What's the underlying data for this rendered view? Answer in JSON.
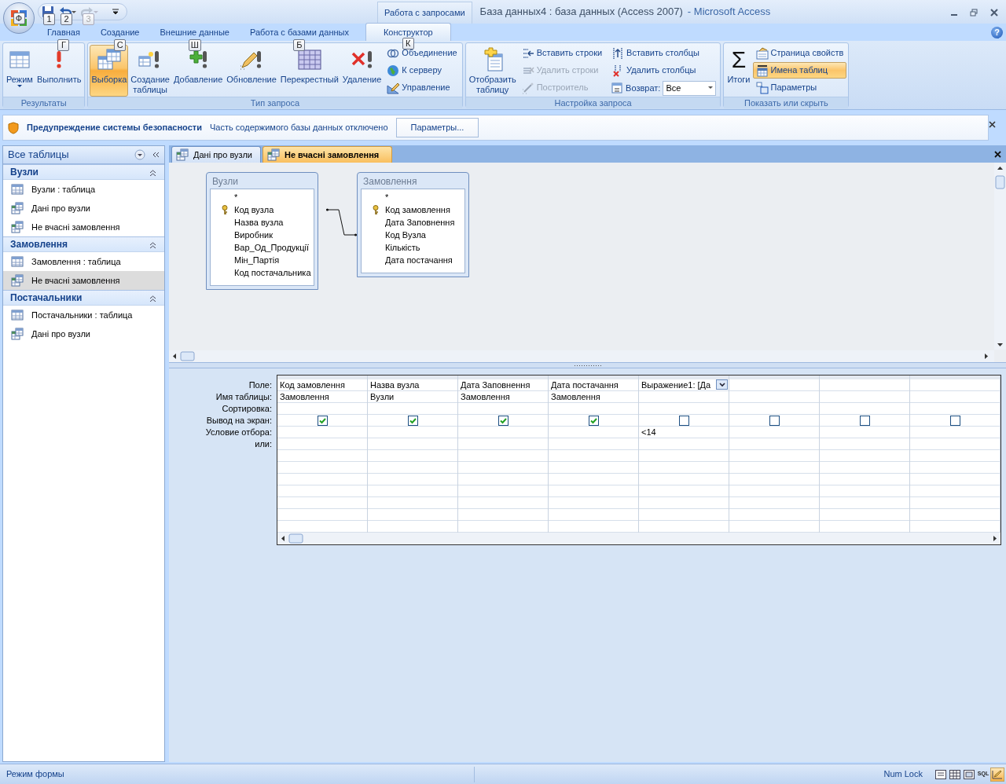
{
  "office_button": {
    "keytip": "Ф"
  },
  "quick_access": [
    {
      "keytip": "1",
      "disabled": false
    },
    {
      "keytip": "2",
      "disabled": false
    },
    {
      "keytip": "3",
      "disabled": true
    }
  ],
  "contextual_tab_group": "Работа с запросами",
  "window": {
    "title": "База данных4 : база данных (Access 2007)",
    "app_name": "- Microsoft Access"
  },
  "help_glyph": "?",
  "ribbon_tabs": [
    {
      "label": "Главная",
      "keytip": "Г",
      "selected": false
    },
    {
      "label": "Создание",
      "keytip": "С",
      "selected": false
    },
    {
      "label": "Внешние данные",
      "keytip": "Ш",
      "selected": false
    },
    {
      "label": "Работа с базами данных",
      "keytip": "Б",
      "selected": false
    },
    {
      "label": "Конструктор",
      "keytip": "К",
      "selected": true
    }
  ],
  "ribbon_groups": [
    {
      "name": "Результаты",
      "items": [
        {
          "kind": "large",
          "label": "Режим",
          "dropdown": true,
          "selected": false,
          "disabled": false
        },
        {
          "kind": "large",
          "label": "Выполнить",
          "dropdown": false,
          "selected": false,
          "disabled": false
        }
      ]
    },
    {
      "name": "Тип запроса",
      "items": [
        {
          "kind": "large",
          "label": "Выборка",
          "dropdown": false,
          "selected": true,
          "disabled": false
        },
        {
          "kind": "large",
          "label": "Создание таблицы",
          "dropdown": false,
          "selected": false,
          "disabled": false
        },
        {
          "kind": "large",
          "label": "Добавление",
          "dropdown": false,
          "selected": false,
          "disabled": false
        },
        {
          "kind": "large",
          "label": "Обновление",
          "dropdown": false,
          "selected": false,
          "disabled": false
        },
        {
          "kind": "large",
          "label": "Перекрестный",
          "dropdown": false,
          "selected": false,
          "disabled": false
        },
        {
          "kind": "large",
          "label": "Удаление",
          "dropdown": false,
          "selected": false,
          "disabled": false
        },
        {
          "kind": "small",
          "label": "Объединение",
          "selected": false,
          "disabled": false
        },
        {
          "kind": "small",
          "label": "К серверу",
          "selected": false,
          "disabled": false
        },
        {
          "kind": "small",
          "label": "Управление",
          "selected": false,
          "disabled": false
        }
      ]
    },
    {
      "name": "Настройка запроса",
      "items": [
        {
          "kind": "large",
          "label": "Отобразить таблицу",
          "dropdown": false,
          "selected": false,
          "disabled": false
        },
        {
          "kind": "small",
          "label": "Вставить строки",
          "selected": false,
          "disabled": false
        },
        {
          "kind": "small",
          "label": "Удалить строки",
          "selected": false,
          "disabled": true
        },
        {
          "kind": "small",
          "label": "Построитель",
          "selected": false,
          "disabled": true
        },
        {
          "kind": "small",
          "label": "Вставить столбцы",
          "selected": false,
          "disabled": false
        },
        {
          "kind": "small",
          "label": "Удалить столбцы",
          "selected": false,
          "disabled": false
        },
        {
          "kind": "combo",
          "label": "Возврат:",
          "value": "Все",
          "disabled": false
        }
      ]
    },
    {
      "name": "Показать или скрыть",
      "items": [
        {
          "kind": "large",
          "label": "Итоги",
          "glyph": "Σ",
          "dropdown": false,
          "selected": false,
          "disabled": false
        },
        {
          "kind": "small",
          "label": "Страница свойств",
          "selected": false,
          "disabled": false
        },
        {
          "kind": "small",
          "label": "Имена таблиц",
          "selected": true,
          "disabled": false
        },
        {
          "kind": "small",
          "label": "Параметры",
          "selected": false,
          "disabled": false
        }
      ]
    }
  ],
  "security_bar": {
    "title": "Предупреждение системы безопасности",
    "message": "Часть содержимого базы данных отключено",
    "button": "Параметры..."
  },
  "nav_pane": {
    "title": "Все таблицы",
    "groups": [
      {
        "name": "Вузли",
        "expanded": true,
        "items": [
          {
            "label": "Вузли : таблица",
            "kind": "table",
            "selected": false
          },
          {
            "label": "Дані про вузли",
            "kind": "query",
            "selected": false
          },
          {
            "label": "Не вчасні замовлення",
            "kind": "query",
            "selected": false
          }
        ]
      },
      {
        "name": "Замовлення",
        "expanded": true,
        "items": [
          {
            "label": "Замовлення : таблица",
            "kind": "table",
            "selected": false
          },
          {
            "label": "Не вчасні замовлення",
            "kind": "query",
            "selected": true
          }
        ]
      },
      {
        "name": "Постачальники",
        "expanded": true,
        "items": [
          {
            "label": "Постачальники : таблица",
            "kind": "table",
            "selected": false
          },
          {
            "label": "Дані про вузли",
            "kind": "query",
            "selected": false
          }
        ]
      }
    ]
  },
  "document_tabs": [
    {
      "label": "Дані про вузли",
      "selected": false
    },
    {
      "label": "Не вчасні замовлення",
      "selected": true
    }
  ],
  "diagram": {
    "tables": [
      {
        "name": "Вузли",
        "fields": [
          {
            "name": "*",
            "primary_key": false,
            "joined": false
          },
          {
            "name": "Код вузла",
            "primary_key": true,
            "joined": true
          },
          {
            "name": "Назва вузла",
            "primary_key": false,
            "joined": false
          },
          {
            "name": "Виробник",
            "primary_key": false,
            "joined": false
          },
          {
            "name": "Вар_Од_Продукції",
            "primary_key": false,
            "joined": false
          },
          {
            "name": "Мін_Партія",
            "primary_key": false,
            "joined": false
          },
          {
            "name": "Код постачальника",
            "primary_key": false,
            "joined": false
          }
        ]
      },
      {
        "name": "Замовлення",
        "fields": [
          {
            "name": "*",
            "primary_key": false,
            "joined": false
          },
          {
            "name": "Код замовлення",
            "primary_key": true,
            "joined": false
          },
          {
            "name": "Дата Заповнення",
            "primary_key": false,
            "joined": false
          },
          {
            "name": "Код Вузла",
            "primary_key": false,
            "joined": true
          },
          {
            "name": "Кількість",
            "primary_key": false,
            "joined": false
          },
          {
            "name": "Дата постачання",
            "primary_key": false,
            "joined": false
          }
        ]
      }
    ]
  },
  "grid": {
    "row_labels": [
      "Поле:",
      "Имя таблицы:",
      "Сортировка:",
      "Вывод на экран:",
      "Условие отбора:",
      "или:"
    ],
    "columns": [
      {
        "field": "Код замовлення",
        "table": "Замовлення",
        "show": true,
        "focused": false
      },
      {
        "field": "Назва вузла",
        "table": "Вузли",
        "show": true,
        "focused": false
      },
      {
        "field": "Дата Заповнення",
        "table": "Замовлення",
        "show": true,
        "focused": false
      },
      {
        "field": "Дата постачання",
        "table": "Замовлення",
        "show": true,
        "focused": false
      },
      {
        "field": "Выражение1: [Да",
        "criteria": "<14",
        "show": false,
        "focused": true
      },
      {
        "show": false,
        "focused": false
      },
      {
        "show": false,
        "focused": false
      },
      {
        "show": false,
        "focused": false
      }
    ]
  },
  "status_bar": {
    "mode": "Режим формы",
    "indicator": "Num Lock",
    "views": [
      {
        "selected": false
      },
      {
        "selected": false
      },
      {
        "selected": false
      },
      {
        "label": "SQL",
        "selected": false
      },
      {
        "selected": true
      }
    ]
  }
}
